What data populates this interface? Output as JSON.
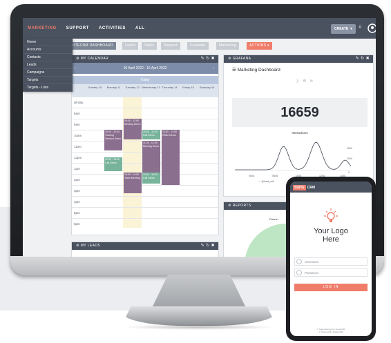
{
  "nav": {
    "items": [
      "MARKETING",
      "SUPPORT",
      "ACTIVITIES",
      "ALL"
    ],
    "create_label": "CREATE",
    "create_caret": "▾",
    "search_icon": "⌕"
  },
  "marketing_menu": [
    "Home",
    "Accounts",
    "Contacts",
    "Leads",
    "Campaigns",
    "Targets",
    "Targets - Lists"
  ],
  "tabs": [
    "UITECRM DASHBOARD",
    "Leads",
    "Sales",
    "Support",
    "Calendar",
    "Marketing",
    "ACTIONS ▾"
  ],
  "calendar": {
    "title": "MY CALENDAR",
    "range": "10 April 2022 - 16 April 2022",
    "today": "Today",
    "prev": "‹",
    "next": "›",
    "controls": "✎ ↻ ✖",
    "days": [
      "Sunday 10",
      "Monday 11",
      "Tuesday 12",
      "Wednesday 13",
      "Thursday 14",
      "Friday 15",
      "Saturday 16"
    ],
    "times": [
      "all-day",
      "8am",
      "9am",
      "10am",
      "11am",
      "12pm",
      "1pm",
      "2pm",
      "3pm",
      "4pm",
      "5pm",
      "6pm"
    ],
    "events": {
      "e1": "10:00 - 12:00 Training Session Demo",
      "e2": "09:00 - 12:00 Meeting Demo",
      "e3": "10:00 - 11:00 Call Demo",
      "e4": "10:00 - 13:00 Office Demo",
      "e5": "11:00 - 12:00 Meeting Demo",
      "e6": "12:30 - 13:00 Call Demo",
      "e7": "13:00 - 14:00 Call Demo",
      "e8": "13:00 - 14:00 Team Meeting"
    }
  },
  "grafana": {
    "title": "GRAFANA",
    "dashboard": "Marketing Dashboard",
    "big_number": "16659",
    "chart_title": "Interactions",
    "y_ticks": [
      "4000",
      "2000",
      "0"
    ],
    "x_ticks": [
      "06/01",
      "08/01",
      "10/01",
      "12/01",
      "14/01"
    ],
    "legend": "— @local_call",
    "controls": "✎ ↻ ✖",
    "toolbar_right": "ⓘ ⊖ ↻"
  },
  "reports": {
    "title": "REPORTS",
    "slice_label": "Partner"
  },
  "leads": {
    "title": "MY LEADS",
    "controls": "✎ ↻ ✖"
  },
  "phone": {
    "brand_tag": "SUITE",
    "brand": "CRM",
    "logo_line1": "Your Logo",
    "logo_line2": "Here",
    "username_placeholder": "Username",
    "password_placeholder": "Password",
    "login_label": "LOG IN",
    "footer_line1": "© Supercharged by SuiteCRM",
    "footer_line2": "© Powered By SugarCRM"
  },
  "colors": {
    "nav_bg": "#4a5260",
    "accent": "#f07c6a",
    "event_purple": "#8b6f8e",
    "event_teal": "#78b39c",
    "pie_green": "#bfe6c4",
    "pie_maroon": "#7b1c2e"
  }
}
